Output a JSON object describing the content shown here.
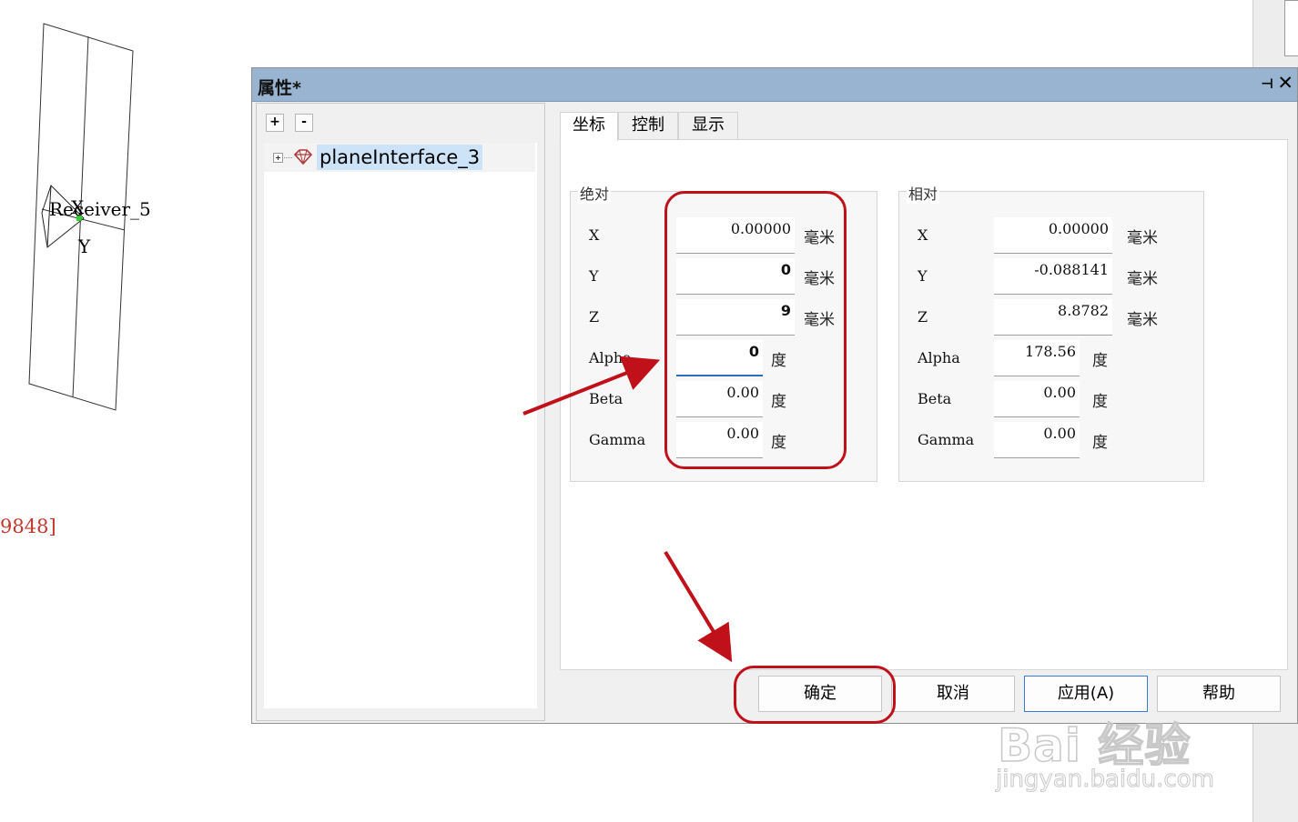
{
  "viewport": {
    "label_receiver": "Receiver_5",
    "label_x": "X",
    "label_y": "Y",
    "coord_fragment": "9848]"
  },
  "dialog": {
    "title": "属性*",
    "pin_icon": "pin-icon",
    "close_icon": "close-icon",
    "pin_glyph": "⊣",
    "close_glyph": "✕"
  },
  "tree": {
    "expand_button": "+",
    "collapse_button": "-",
    "item_label": "planeInterface_3",
    "item_icon": "gem-icon"
  },
  "tabs": [
    {
      "label": "坐标",
      "active": true
    },
    {
      "label": "控制",
      "active": false
    },
    {
      "label": "显示",
      "active": false
    }
  ],
  "absolute": {
    "title": "绝对",
    "fields": [
      {
        "label": "X",
        "value": "0.00000",
        "unit": "毫米"
      },
      {
        "label": "Y",
        "value": "0",
        "unit": "毫米"
      },
      {
        "label": "Z",
        "value": "9",
        "unit": "毫米"
      },
      {
        "label": "Alpha",
        "value": "0",
        "unit": "度"
      },
      {
        "label": "Beta",
        "value": "0.00",
        "unit": "度"
      },
      {
        "label": "Gamma",
        "value": "0.00",
        "unit": "度"
      }
    ]
  },
  "relative": {
    "title": "相对",
    "fields": [
      {
        "label": "X",
        "value": "0.00000",
        "unit": "毫米"
      },
      {
        "label": "Y",
        "value": "-0.088141",
        "unit": "毫米"
      },
      {
        "label": "Z",
        "value": "8.8782",
        "unit": "毫米"
      },
      {
        "label": "Alpha",
        "value": "178.56",
        "unit": "度"
      },
      {
        "label": "Beta",
        "value": "0.00",
        "unit": "度"
      },
      {
        "label": "Gamma",
        "value": "0.00",
        "unit": "度"
      }
    ]
  },
  "buttons": {
    "ok": "确定",
    "cancel": "取消",
    "apply": "应用(A)",
    "help": "帮助"
  },
  "watermark": {
    "brand": "Bai 经验",
    "url": "jingyan.baidu.com"
  },
  "colors": {
    "titlebar": "#99b4d1",
    "annotation": "#c0101a",
    "selection": "#cde3f7"
  }
}
